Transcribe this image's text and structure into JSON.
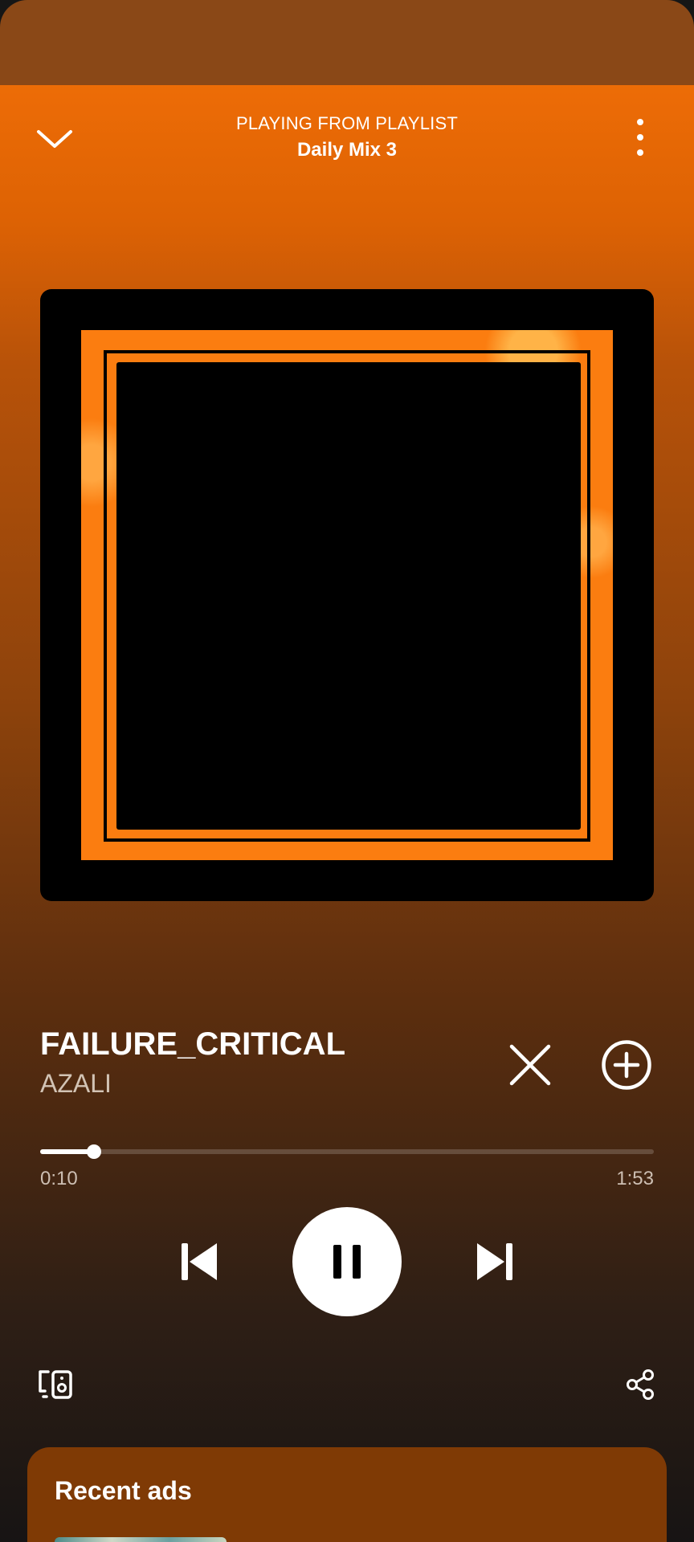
{
  "header": {
    "caption": "PLAYING FROM PLAYLIST",
    "playlist_name": "Daily Mix 3",
    "collapse_icon": "chevron-down-icon",
    "menu_icon": "more-vertical-icon"
  },
  "track": {
    "title": "FAILURE_CRITICAL",
    "artist": "AZALI"
  },
  "actions": {
    "hide_icon": "close-icon",
    "add_icon": "add-circle-icon"
  },
  "progress": {
    "elapsed": "0:10",
    "total": "1:53",
    "fraction": 0.088
  },
  "controls": {
    "previous_icon": "skip-previous-icon",
    "pause_icon": "pause-icon",
    "next_icon": "skip-next-icon"
  },
  "footer": {
    "devices_icon": "connect-device-icon",
    "share_icon": "share-icon"
  },
  "ads": {
    "title": "Recent ads"
  },
  "colors": {
    "accent": "#ed6c06",
    "status_strip": "#8a4817",
    "ads_card": "#7f3a05",
    "artwork_orange": "#fb7d10"
  }
}
